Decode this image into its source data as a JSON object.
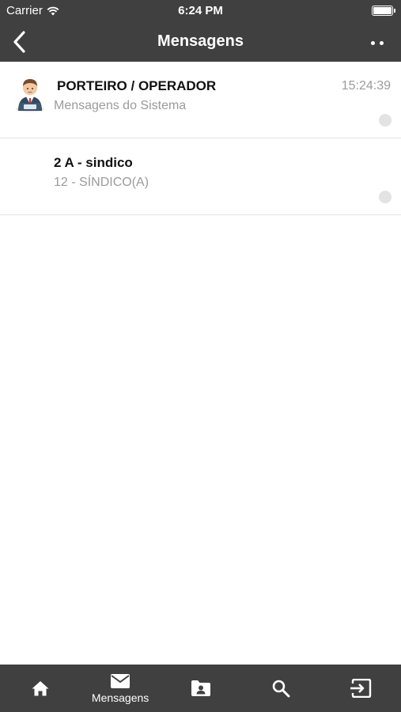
{
  "status_bar": {
    "carrier": "Carrier",
    "time": "6:24 PM"
  },
  "nav": {
    "title": "Mensagens",
    "back_icon": "chevron-left-icon",
    "more_icon": "more-dots-icon"
  },
  "messages": [
    {
      "title": "PORTEIRO / OPERADOR",
      "subtitle": "Mensagens do Sistema",
      "time": "15:24:39",
      "avatar": "doorman-avatar-icon"
    },
    {
      "title": "2 A - sindico",
      "subtitle": "12 - SÍNDICO(A)",
      "time": ""
    }
  ],
  "tabbar": {
    "tabs": [
      {
        "icon": "home-icon",
        "label": ""
      },
      {
        "icon": "envelope-icon",
        "label": "Mensagens",
        "active": true
      },
      {
        "icon": "contacts-folder-icon",
        "label": ""
      },
      {
        "icon": "search-icon",
        "label": ""
      },
      {
        "icon": "logout-icon",
        "label": ""
      }
    ]
  },
  "colors": {
    "header_bg": "#404040",
    "tabbar_bg": "#404040",
    "subtitle_text": "#9b9b9b",
    "unread_dot": "#e3e3e3"
  }
}
